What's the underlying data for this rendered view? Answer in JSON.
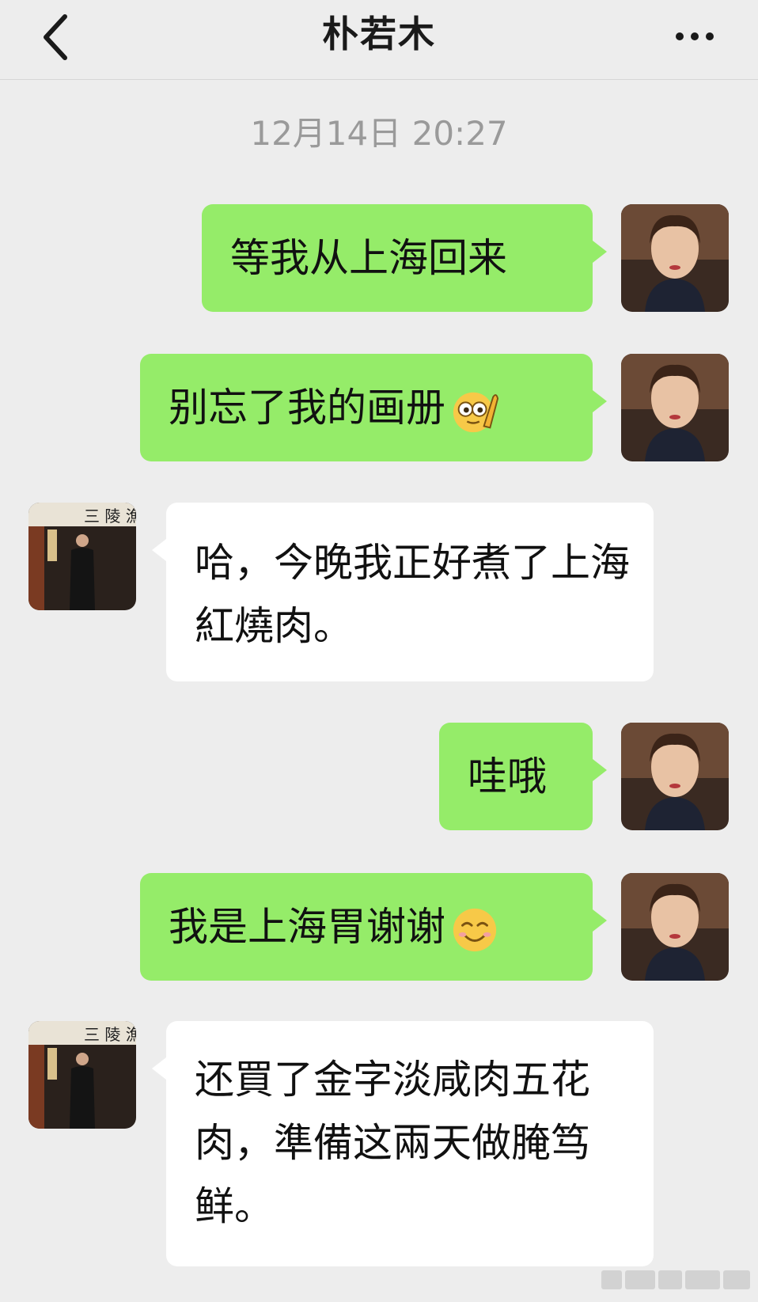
{
  "header": {
    "title": "朴若木",
    "back_icon": "chevron-left-icon",
    "more_icon": "ellipsis-icon"
  },
  "timestamp": "12月14日 20:27",
  "messages": [
    {
      "side": "right",
      "text": "等我从上海回来"
    },
    {
      "side": "right",
      "text": "别忘了我的画册",
      "emoji": "salute-face-emoji"
    },
    {
      "side": "left",
      "text": "哈，今晚我正好煮了上海紅燒肉。"
    },
    {
      "side": "right",
      "text": "哇哦"
    },
    {
      "side": "right",
      "text": "我是上海胃谢谢",
      "emoji": "smiling-face-emoji"
    },
    {
      "side": "left",
      "text": "还買了金字淡咸肉五花肉，準備这兩天做腌笃鲜。"
    }
  ],
  "colors": {
    "background": "#ededed",
    "self_bubble": "#95ec69",
    "other_bubble": "#ffffff",
    "timestamp_text": "#9a9a9a"
  }
}
